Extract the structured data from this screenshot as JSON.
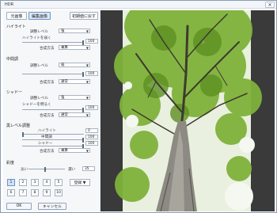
{
  "window": {
    "title": "HDR",
    "close_glyph": "✕"
  },
  "toolbar": {
    "tab_original": "元画像",
    "tab_edited": "編集画像",
    "reset_label": "初期値に戻す"
  },
  "highlight": {
    "section_label": "ハイライト",
    "adjust_label": "調整レベル",
    "adjust_value": "強",
    "soften_label": "ハイライトを弱く",
    "soften_value": "100",
    "blend_label": "合成方法",
    "blend_value": "乗算"
  },
  "midtone": {
    "section_label": "中間調",
    "adjust_label": "調整レベル",
    "adjust_value": "弱",
    "value": "100",
    "blend_label": "合成方法",
    "blend_value": "通常"
  },
  "shadow": {
    "section_label": "シャドー",
    "adjust_label": "調整レベル",
    "adjust_value": "強",
    "soften_label": "シャドーを明るく",
    "soften_value": "100",
    "blend_label": "合成方法",
    "blend_value": "通常"
  },
  "blacklevel": {
    "section_label": "黒レベル調整",
    "highlight_label": "ハイライト",
    "highlight_value": "0",
    "midtone_label": "中間調",
    "midtone_value": "100",
    "shadow_label": "シャドー",
    "shadow_value": "100",
    "blend_label": "合成方法",
    "blend_value": "乗算"
  },
  "saturation": {
    "section_label": "彩度",
    "low_label": "淡い",
    "high_label": "濃い",
    "value": "35"
  },
  "presets": {
    "row1": [
      "1",
      "2",
      "3",
      "4",
      "5"
    ],
    "row2": [
      "6",
      "7",
      "8",
      "9",
      "10"
    ],
    "save_label": "登録 ▼"
  },
  "buttons": {
    "ok_label": "OK",
    "cancel_label": "キャンセル"
  },
  "icons": {
    "close": "close-icon",
    "dropdown": "chevron-down-icon"
  },
  "colors": {
    "accent": "#dbe8f7",
    "preview_bg": "#3a3a3a",
    "foliage": "#7fb23a"
  }
}
